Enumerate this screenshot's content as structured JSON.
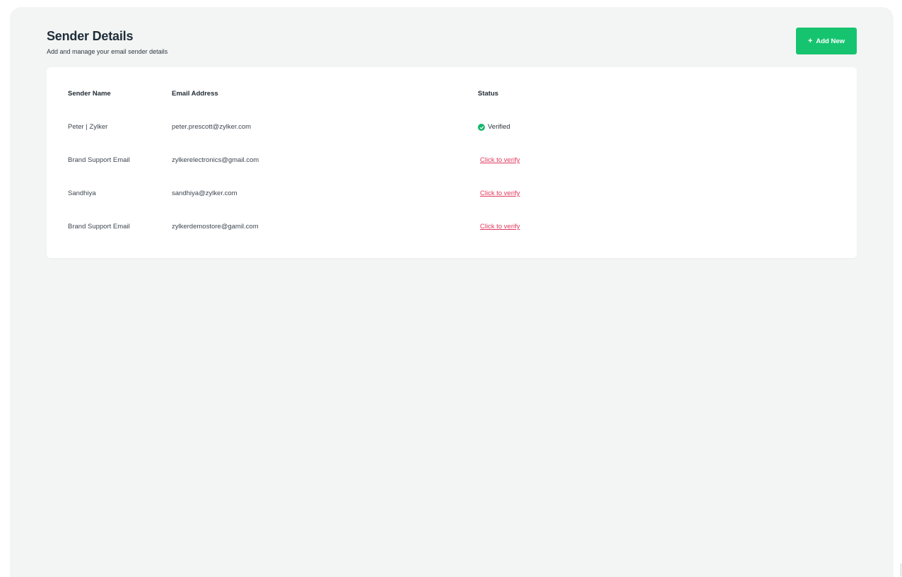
{
  "header": {
    "title": "Sender Details",
    "subtitle": "Add and manage your email sender details",
    "add_button_label": "Add New",
    "add_button_icon": "+"
  },
  "table": {
    "columns": {
      "name": "Sender Name",
      "email": "Email Address",
      "status": "Status"
    },
    "rows": [
      {
        "name": "Peter | Zylker",
        "email": "peter.prescott@zylker.com",
        "status": "Verified",
        "verified": true
      },
      {
        "name": "Brand Support Email",
        "email": "zylkerelectronics@gmail.com",
        "status": "Click to verify",
        "verified": false
      },
      {
        "name": "Sandhiya",
        "email": "sandhiya@zylker.com",
        "status": "Click to verify",
        "verified": false
      },
      {
        "name": "Brand Support Email",
        "email": "zylkerdemostore@gamil.com",
        "status": "Click to verify",
        "verified": false
      }
    ]
  },
  "colors": {
    "accent": "#16c46f",
    "verified": "#16b56b",
    "link": "#e0395c",
    "panel_bg": "#f3f5f4"
  },
  "icons": {
    "verified": "check-circle-icon",
    "add": "plus-icon"
  }
}
